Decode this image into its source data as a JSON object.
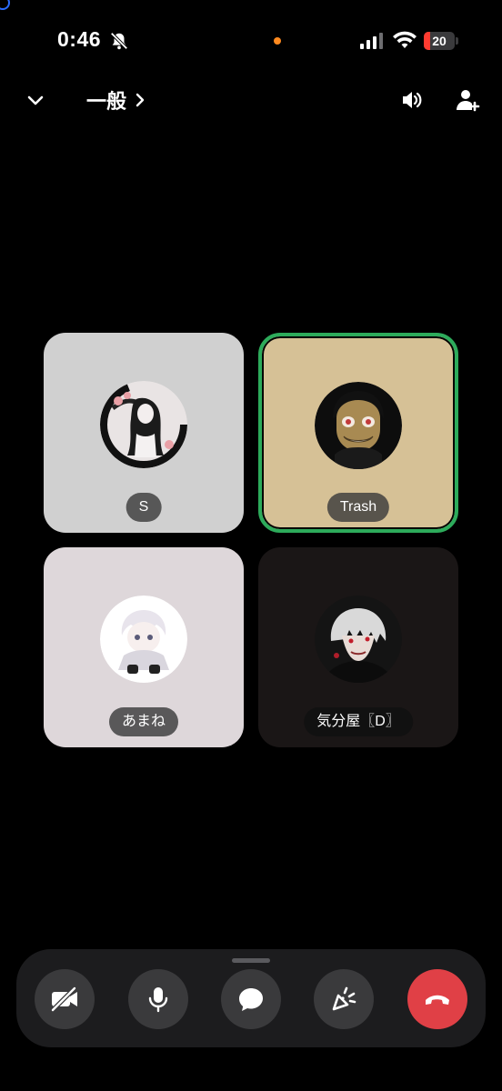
{
  "status_bar": {
    "time": "0:46",
    "battery_level": "20",
    "accent_recording_dot": "#ff8a1f"
  },
  "header": {
    "channel_name": "一般",
    "icons": [
      "chevron-down-icon",
      "chevron-right-icon",
      "speaker-icon",
      "add-user-icon"
    ]
  },
  "participants": [
    {
      "name": "S",
      "tile_color": "#d0d0d0",
      "speaking": false
    },
    {
      "name": "Trash",
      "tile_color": "#d6c196",
      "speaking": true
    },
    {
      "name": "あまね",
      "tile_color": "#ded7da",
      "speaking": false
    },
    {
      "name": "気分屋〖D〗",
      "tile_color": "#1a1616",
      "speaking": false
    }
  ],
  "controls": {
    "icons": [
      "camera-off-icon",
      "microphone-icon",
      "chat-icon",
      "activity-icon",
      "hang-up-icon"
    ],
    "end_call_color": "#e04046",
    "speaking_border_color": "#2dab5b"
  }
}
